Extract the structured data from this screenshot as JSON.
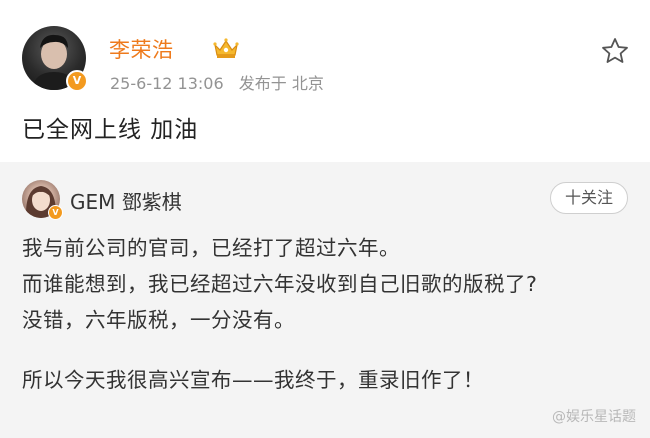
{
  "post": {
    "author": "李荣浩",
    "date": "25-6-12 13:06",
    "source": "发布于 北京",
    "text": "已全网上线 加油",
    "verified_mark": "V"
  },
  "repost": {
    "author": "GEM 鄧紫棋",
    "follow_label": "十关注",
    "verified_mark": "V",
    "lines": [
      "我与前公司的官司，已经打了超过六年。",
      "而谁能想到，我已经超过六年没收到自己旧歌的版税了?",
      "没错，六年版税，一分没有。",
      "所以今天我很高兴宣布——我终于，重录旧作了！"
    ]
  },
  "watermark": "@娱乐星话题",
  "colors": {
    "username": "#ee7a1c",
    "meta": "#939393",
    "repost_bg": "#f4f4f4",
    "badge": "#f39a1f"
  },
  "icons": {
    "crown": "crown-icon",
    "star": "star-icon",
    "verified": "verified-badge-icon"
  }
}
